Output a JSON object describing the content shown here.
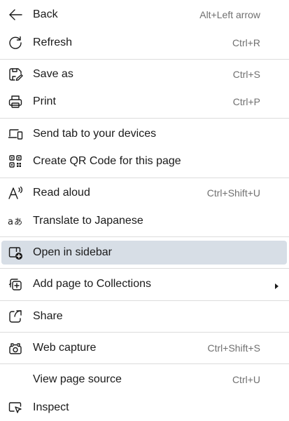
{
  "menu": {
    "items": [
      {
        "label": "Back",
        "shortcut": "Alt+Left arrow",
        "icon": "back-arrow-icon"
      },
      {
        "label": "Refresh",
        "shortcut": "Ctrl+R",
        "icon": "refresh-icon"
      },
      {
        "label": "Save as",
        "shortcut": "Ctrl+S",
        "icon": "save-as-icon"
      },
      {
        "label": "Print",
        "shortcut": "Ctrl+P",
        "icon": "printer-icon"
      },
      {
        "label": "Send tab to your devices",
        "shortcut": "",
        "icon": "devices-icon"
      },
      {
        "label": "Create QR Code for this page",
        "shortcut": "",
        "icon": "qr-code-icon"
      },
      {
        "label": "Read aloud",
        "shortcut": "Ctrl+Shift+U",
        "icon": "read-aloud-icon"
      },
      {
        "label": "Translate to Japanese",
        "shortcut": "",
        "icon": "translate-icon"
      },
      {
        "label": "Open in sidebar",
        "shortcut": "",
        "icon": "open-in-sidebar-icon",
        "highlighted": true
      },
      {
        "label": "Add page to Collections",
        "shortcut": "",
        "icon": "collections-icon",
        "submenu": true
      },
      {
        "label": "Share",
        "shortcut": "",
        "icon": "share-icon"
      },
      {
        "label": "Web capture",
        "shortcut": "Ctrl+Shift+S",
        "icon": "web-capture-icon"
      },
      {
        "label": "View page source",
        "shortcut": "Ctrl+U",
        "icon": ""
      },
      {
        "label": "Inspect",
        "shortcut": "",
        "icon": "inspect-icon"
      }
    ]
  },
  "colors": {
    "highlight_background": "#d7dee6",
    "divider": "#dcdcdc",
    "shortcut_text": "#707070",
    "text": "#1a1a1a"
  }
}
